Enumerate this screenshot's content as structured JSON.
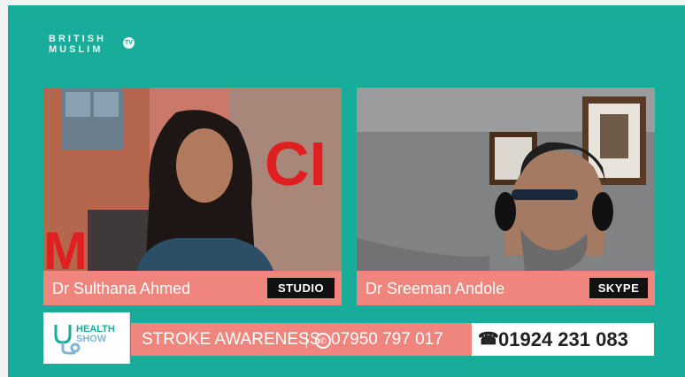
{
  "brand": {
    "line1": "BRITISH",
    "line2": "MUSLIM",
    "badge": "TV"
  },
  "panels": [
    {
      "name": "Dr Sulthana Ahmed",
      "tag": "STUDIO"
    },
    {
      "name": "Dr Sreeman Andole",
      "tag": "SKYPE"
    }
  ],
  "ticker": {
    "show_logo_top": "HEALTH",
    "show_logo_bottom": "SHOW",
    "topic": "STROKE AWARENESS",
    "whatsapp_number": "07950 797 017",
    "phone_number": "01924 231 083"
  },
  "colors": {
    "background": "#18ad9b",
    "accent": "#f0857e",
    "tag_bg": "#111111"
  },
  "icons": [
    "whatsapp-icon",
    "phone-icon",
    "stethoscope-icon"
  ]
}
